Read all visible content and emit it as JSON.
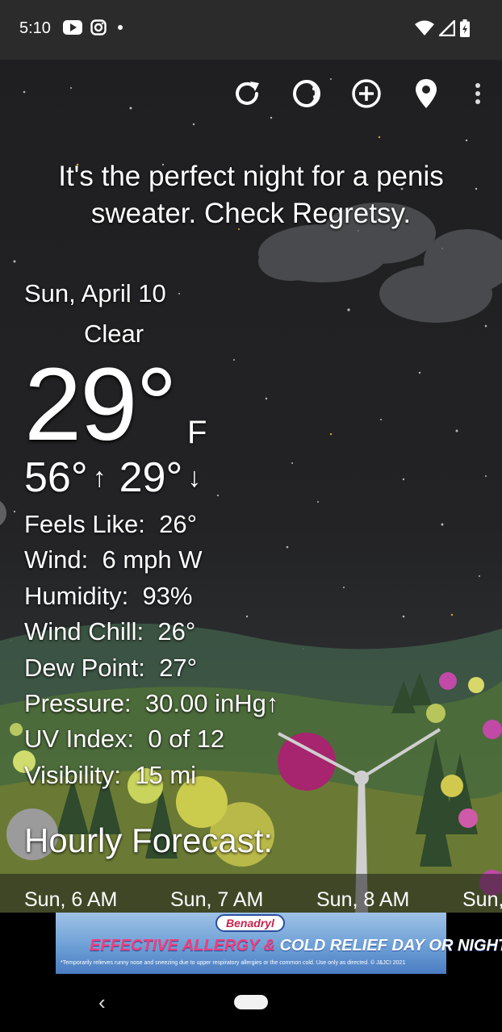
{
  "status_bar": {
    "time": "5:10",
    "left_icons": [
      "youtube-icon",
      "instagram-icon",
      "notification-dot-icon"
    ],
    "right_icons": [
      "wifi-icon",
      "cell-signal-icon",
      "battery-charging-icon"
    ]
  },
  "toolbar": {
    "buttons": [
      "refresh-icon",
      "theme-icon",
      "add-location-icon",
      "location-pin-icon",
      "more-options-icon"
    ]
  },
  "headline": "It's the perfect night for a penis sweater. Check Regretsy.",
  "current": {
    "date": "Sun, April 10",
    "condition": "Clear",
    "condition_icon": "crescent-moon-icon",
    "temperature": "29°",
    "unit": "F",
    "high": "56°",
    "low": "29°"
  },
  "details": [
    {
      "label": "Feels Like:",
      "value": "26°"
    },
    {
      "label": "Wind:",
      "value": "6 mph W"
    },
    {
      "label": "Humidity:",
      "value": "93%"
    },
    {
      "label": "Wind Chill:",
      "value": "26°"
    },
    {
      "label": "Dew Point:",
      "value": "27°"
    },
    {
      "label": "Pressure:",
      "value": "30.00 inHg↑"
    },
    {
      "label": "UV Index:",
      "value": "0 of 12"
    },
    {
      "label": "Visibility:",
      "value": "15 mi"
    }
  ],
  "hourly": {
    "title": "Hourly Forecast:",
    "items": [
      "Sun, 6 AM",
      "Sun, 7 AM",
      "Sun, 8 AM",
      "Sun,"
    ]
  },
  "ad": {
    "brand": "Benadryl",
    "headline_pink": "EFFECTIVE ALLERGY &",
    "headline_white": "COLD RELIEF DAY OR NIGHT*",
    "fine_print": "*Temporarily relieves runny nose and sneezing due to upper respiratory allergies or the common cold. Use only as directed. © J&JCI 2021"
  },
  "colors": {
    "sky": "#1f1f21",
    "moon": "#1e6fd6",
    "ad_pink": "#f23f7a"
  }
}
